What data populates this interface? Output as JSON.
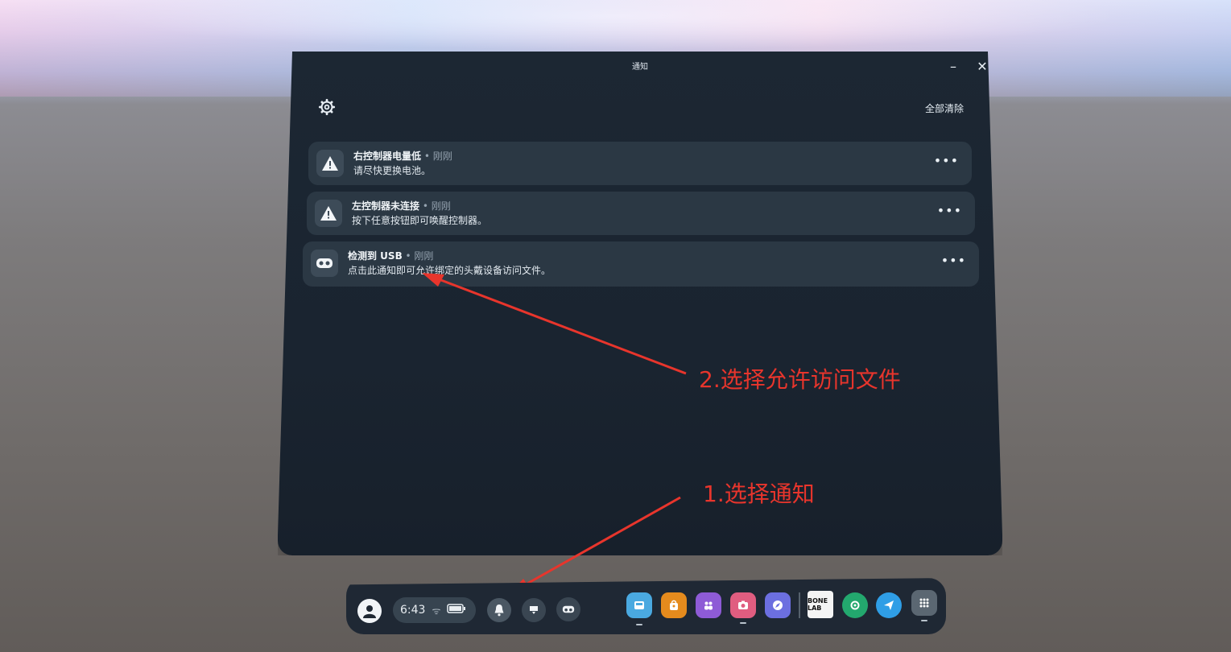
{
  "window": {
    "title": "通知",
    "clear_all_label": "全部清除"
  },
  "notifications": [
    {
      "title": "右控制器电量低",
      "time": " • 刚刚",
      "body": "请尽快更换电池。",
      "icon": "warning-icon"
    },
    {
      "title": "左控制器未连接",
      "time": " • 刚刚",
      "body": "按下任意按钮即可唤醒控制器。",
      "icon": "warning-icon"
    },
    {
      "title": "检测到 USB",
      "time": " • 刚刚",
      "body": "点击此通知即可允许绑定的头戴设备访问文件。",
      "icon": "headset-icon"
    }
  ],
  "annotations": {
    "step1": "1.选择通知",
    "step2": "2.选择允许访问文件"
  },
  "taskbar": {
    "time": "6:43",
    "apps": [
      "gallery-app",
      "store-app",
      "people-app",
      "camera-app",
      "explore-app",
      "bonelab-app",
      "settings-app",
      "messenger-app",
      "app-library"
    ],
    "bonelab_label": "BONE LAB",
    "colors": {
      "accent_red": "#e8352c",
      "panel_bg": "#1c2733",
      "card_bg": "#2b3844"
    }
  }
}
